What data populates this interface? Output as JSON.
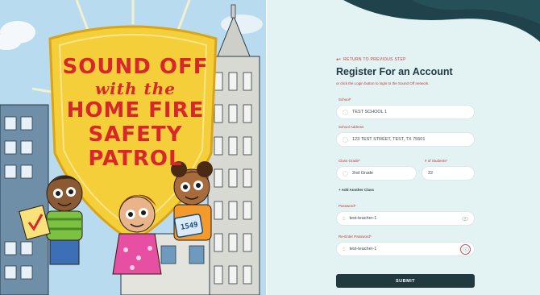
{
  "hero": {
    "title_line1": "SOUND OFF",
    "title_line2": "with the",
    "title_line3": "HOME FIRE",
    "title_line4": "SAFETY",
    "title_line5": "PATROL",
    "badge_number": "1549",
    "colors": {
      "shield": "#f4cf3a",
      "title": "#d8262c",
      "sky": "#b9dbf0"
    }
  },
  "form": {
    "back_link": "RETURN TO PREVIOUS STEP",
    "title": "Register For an Account",
    "subtitle": "or click the Login button to login to the Sound Off network.",
    "fields": {
      "school": {
        "label": "School*",
        "value": "TEST SCHOOL 1"
      },
      "school_address": {
        "label": "School Address",
        "value": "123 TEST STREET, TEST, TX 75501"
      },
      "class_grade": {
        "label": "Class Grade*",
        "value": "2nd Grade"
      },
      "num_students": {
        "label": "# of Students*",
        "value": "22"
      },
      "password": {
        "label": "Password*",
        "value": "test-teacher-1"
      },
      "re_password": {
        "label": "Re-Enter Password*",
        "value": "test-teacher-1"
      }
    },
    "add_class": "+ Add Another Class",
    "submit": "SUBMIT",
    "colors": {
      "accent": "#c23b3b",
      "button": "#213a40",
      "panel": "#e3f2f2"
    }
  }
}
